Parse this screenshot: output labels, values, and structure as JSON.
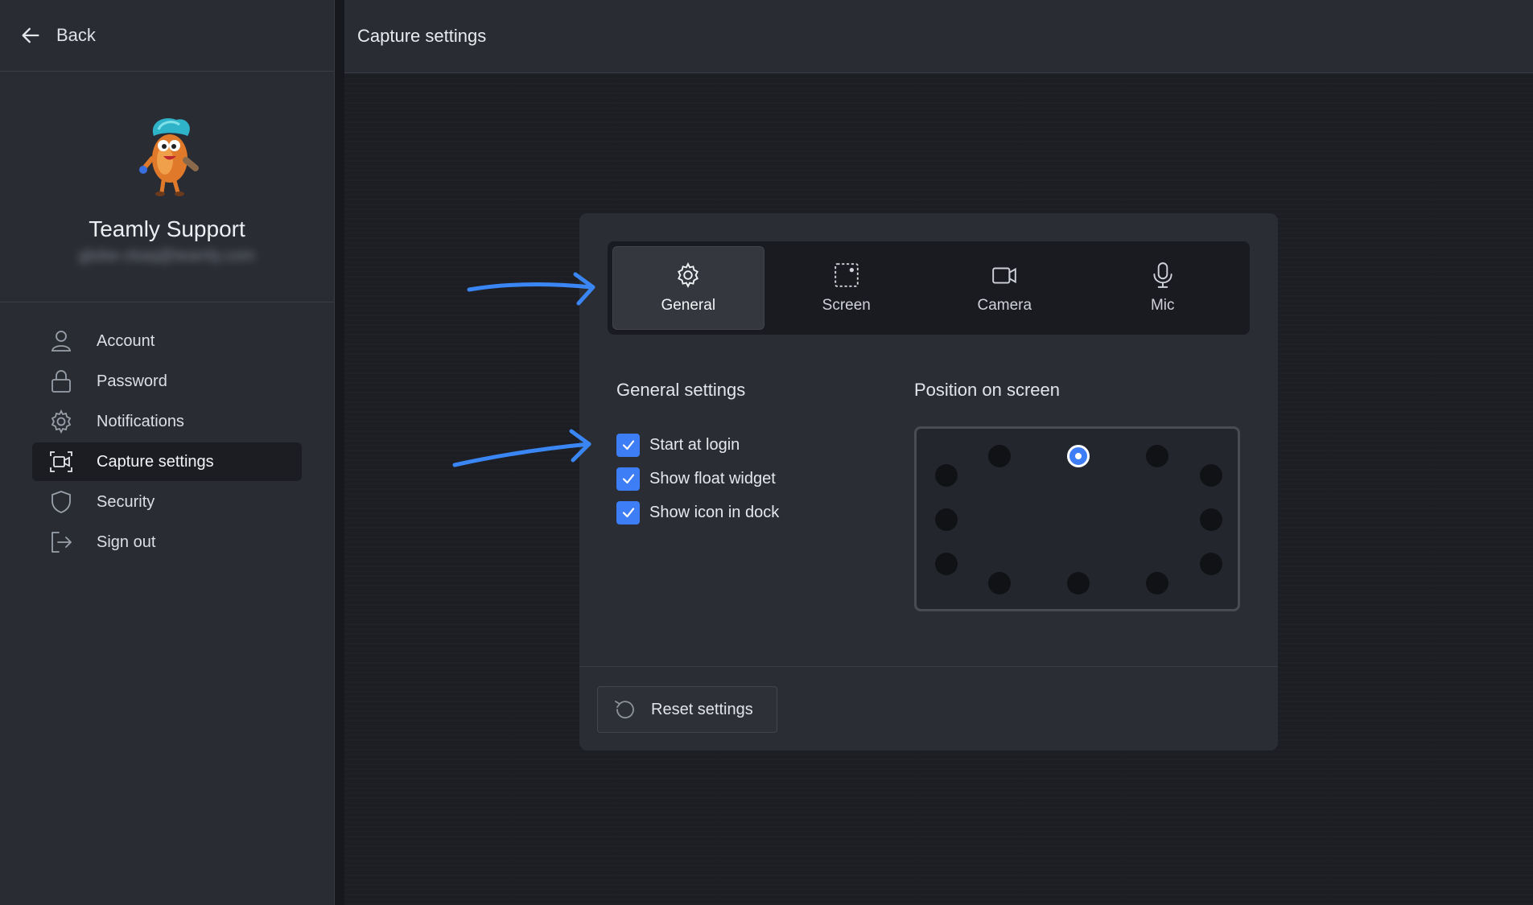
{
  "sidebar": {
    "back_label": "Back",
    "profile": {
      "name": "Teamly Support",
      "email": "globe-ckaq@teamly.com"
    },
    "nav": [
      {
        "label": "Account",
        "icon": "user-icon"
      },
      {
        "label": "Password",
        "icon": "lock-icon"
      },
      {
        "label": "Notifications",
        "icon": "gear-icon"
      },
      {
        "label": "Capture settings",
        "icon": "capture-icon",
        "active": true
      },
      {
        "label": "Security",
        "icon": "shield-icon"
      },
      {
        "label": "Sign out",
        "icon": "sign-out-icon"
      }
    ]
  },
  "main": {
    "title": "Capture settings",
    "tabs": [
      {
        "label": "General",
        "icon": "gear-icon",
        "active": true
      },
      {
        "label": "Screen",
        "icon": "screen-region-icon"
      },
      {
        "label": "Camera",
        "icon": "camera-icon"
      },
      {
        "label": "Mic",
        "icon": "microphone-icon"
      }
    ],
    "general": {
      "title": "General settings",
      "options": [
        {
          "label": "Start at login",
          "checked": true
        },
        {
          "label": "Show float widget",
          "checked": true
        },
        {
          "label": "Show icon in dock",
          "checked": true
        }
      ]
    },
    "position": {
      "title": "Position on screen",
      "selected": "top-center"
    },
    "reset_label": "Reset settings"
  },
  "colors": {
    "accent": "#3d7df5",
    "sidebar_bg": "#2a2c34",
    "main_bg": "#1c1e24",
    "card_bg": "#2b2d35",
    "annotation_arrow": "#3a86f5"
  }
}
